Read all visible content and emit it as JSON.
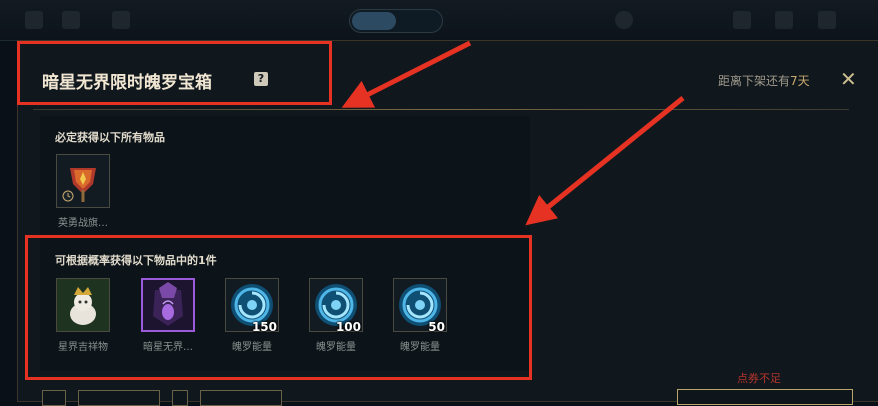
{
  "dialog": {
    "title": "暗星无界限时魄罗宝箱",
    "remaining_prefix": "距离下架还有",
    "remaining_days": "7天",
    "close_symbol": "✕",
    "help_symbol": "?"
  },
  "guaranteed": {
    "label": "必定获得以下所有物品",
    "items": [
      {
        "name": "英勇战旗…",
        "icon": "banner-icon"
      }
    ]
  },
  "random": {
    "label": "可根据概率获得以下物品中的1件",
    "items": [
      {
        "name": "星界吉祥物",
        "icon": "mascot-icon",
        "qty": ""
      },
      {
        "name": "暗星无界…",
        "icon": "dark-star-icon",
        "qty": ""
      },
      {
        "name": "魄罗能量",
        "icon": "poro-energy-icon",
        "qty": "150"
      },
      {
        "name": "魄罗能量",
        "icon": "poro-energy-icon",
        "qty": "100"
      },
      {
        "name": "魄罗能量",
        "icon": "poro-energy-icon",
        "qty": "50"
      }
    ]
  },
  "footer": {
    "insufficient_text": "点券不足"
  },
  "colors": {
    "accent_gold": "#c8aa6e",
    "annotation_red": "#e53222",
    "rare_purple": "#9b5ad9",
    "warning_red": "#b3342c"
  }
}
